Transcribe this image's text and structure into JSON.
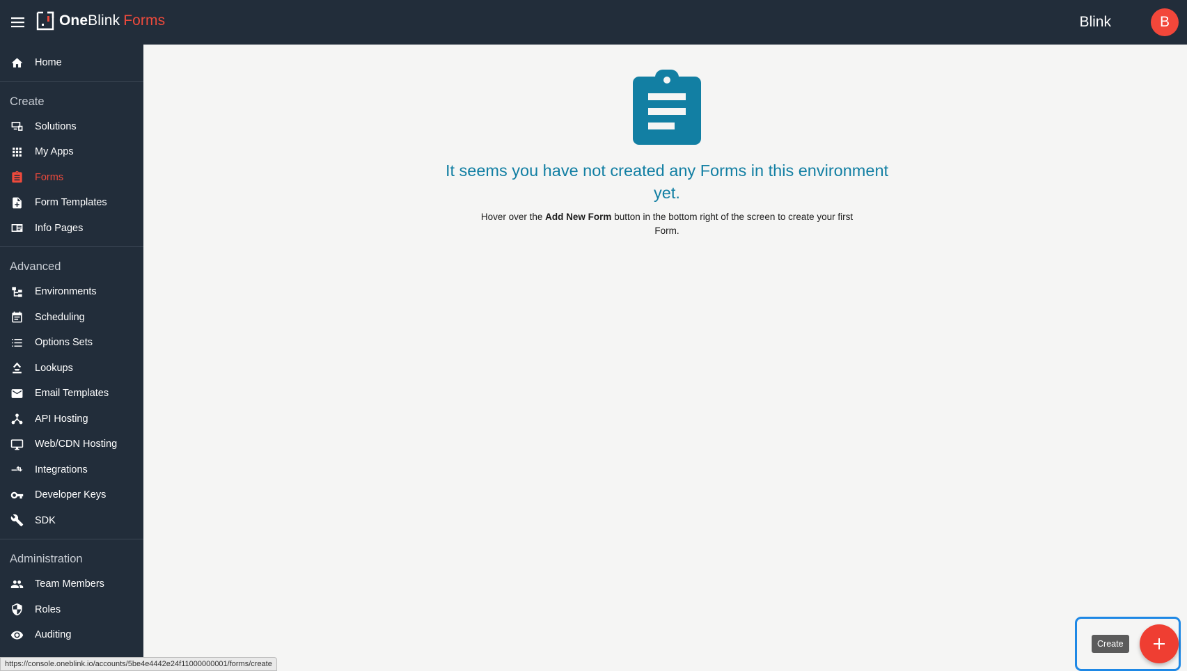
{
  "header": {
    "brand_bold": "One",
    "brand_light": "Blink",
    "brand_product": "Forms",
    "user_name": "Blink",
    "avatar_initial": "B"
  },
  "sidebar": {
    "home": {
      "label": "Home",
      "icon": "home-icon"
    },
    "sections": [
      {
        "title": "Create",
        "items": [
          {
            "label": "Solutions",
            "icon": "solutions-icon",
            "active": false
          },
          {
            "label": "My Apps",
            "icon": "apps-grid-icon",
            "active": false
          },
          {
            "label": "Forms",
            "icon": "clipboard-icon",
            "active": true
          },
          {
            "label": "Form Templates",
            "icon": "file-plus-icon",
            "active": false
          },
          {
            "label": "Info Pages",
            "icon": "info-pages-icon",
            "active": false
          }
        ]
      },
      {
        "title": "Advanced",
        "items": [
          {
            "label": "Environments",
            "icon": "environments-icon",
            "active": false
          },
          {
            "label": "Scheduling",
            "icon": "calendar-icon",
            "active": false
          },
          {
            "label": "Options Sets",
            "icon": "list-icon",
            "active": false
          },
          {
            "label": "Lookups",
            "icon": "lookup-icon",
            "active": false
          },
          {
            "label": "Email Templates",
            "icon": "email-icon",
            "active": false
          },
          {
            "label": "API Hosting",
            "icon": "api-icon",
            "active": false
          },
          {
            "label": "Web/CDN Hosting",
            "icon": "monitor-icon",
            "active": false
          },
          {
            "label": "Integrations",
            "icon": "integrations-icon",
            "active": false
          },
          {
            "label": "Developer Keys",
            "icon": "key-icon",
            "active": false
          },
          {
            "label": "SDK",
            "icon": "wrench-icon",
            "active": false
          }
        ]
      },
      {
        "title": "Administration",
        "items": [
          {
            "label": "Team Members",
            "icon": "team-icon",
            "active": false
          },
          {
            "label": "Roles",
            "icon": "shield-icon",
            "active": false
          },
          {
            "label": "Auditing",
            "icon": "eye-icon",
            "active": false
          }
        ]
      }
    ]
  },
  "main": {
    "empty_heading": "It seems you have not created any Forms in this environment yet.",
    "empty_text_before": "Hover over the ",
    "empty_text_bold": "Add New Form",
    "empty_text_after": " button in the bottom right of the screen to create your first Form.",
    "empty_icon": "clipboard-icon"
  },
  "fab": {
    "tooltip": "Create",
    "icon": "plus-icon"
  },
  "status_bar": {
    "url": "https://console.oneblink.io/accounts/5be4e4442e24f11000000001/forms/create"
  },
  "colors": {
    "sidebar_bg": "#222d3a",
    "accent_red": "#ee4a3c",
    "heading_blue": "#127fa3",
    "focus_blue": "#1e88e5"
  }
}
